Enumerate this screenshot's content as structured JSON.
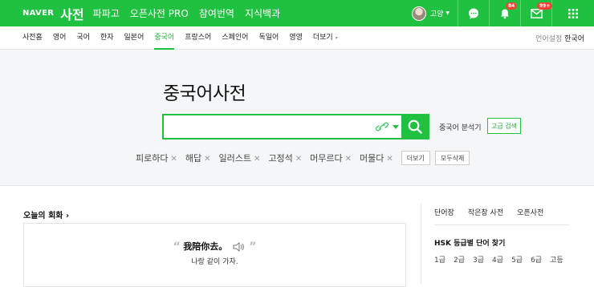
{
  "header": {
    "logo": "NAVER",
    "dict_label": "사전",
    "menu": [
      "파파고",
      "오픈사전 PRO",
      "참여번역",
      "지식백과"
    ],
    "user_name": "고양",
    "notification_count": "84",
    "mail_count": "99+",
    "icons": [
      "chat-icon",
      "bell-icon",
      "mail-icon",
      "apps-grid-icon"
    ],
    "colors": {
      "brand": "#20c140",
      "badge": "#f44336"
    }
  },
  "subnav": {
    "items": [
      "사전홈",
      "영어",
      "국어",
      "한자",
      "일본어",
      "중국어",
      "프랑스어",
      "스페인어",
      "독일어",
      "영영",
      "더보기"
    ],
    "active": "중국어",
    "lang_label": "언어설정",
    "lang_value": "한국어"
  },
  "search": {
    "title": "중국어사전",
    "input_value": "",
    "analyzer_label": "중국어 분석기",
    "advanced_label": "고급 검색",
    "recent": [
      "피로하다",
      "해답",
      "일러스트",
      "고정석",
      "머무르다",
      "머물다"
    ],
    "more_label": "더보기",
    "delete_all_label": "모두삭제"
  },
  "today": {
    "title": "오늘의 회화",
    "chinese": "我陪你去。",
    "korean": "나랑 같이 가자."
  },
  "sidebar": {
    "tabs": [
      "단어장",
      "작은창 사전",
      "오픈사전"
    ],
    "hsk_title": "HSK 등급별 단어 찾기",
    "hsk_levels": [
      "1급",
      "2급",
      "3급",
      "4급",
      "5급",
      "6급",
      "고등"
    ]
  }
}
